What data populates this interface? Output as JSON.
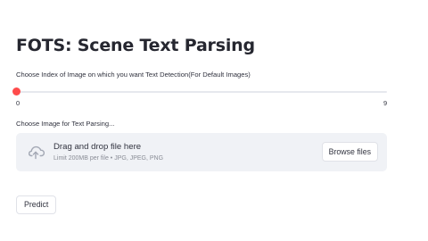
{
  "page": {
    "title": "FOTS: Scene Text Parsing"
  },
  "slider": {
    "label": "Choose Index of Image on which you want Text Detection(For Default Images)",
    "min_label": "0",
    "max_label": "9",
    "min": 0,
    "max": 9,
    "value": 0,
    "accent_color": "#ff4b4b"
  },
  "uploader": {
    "label": "Choose Image for Text Parsing...",
    "drop_title": "Drag and drop file here",
    "drop_hint": "Limit 200MB per file • JPG, JPEG, PNG",
    "browse_label": "Browse files",
    "icon": "cloud-upload-icon"
  },
  "actions": {
    "predict_label": "Predict"
  }
}
